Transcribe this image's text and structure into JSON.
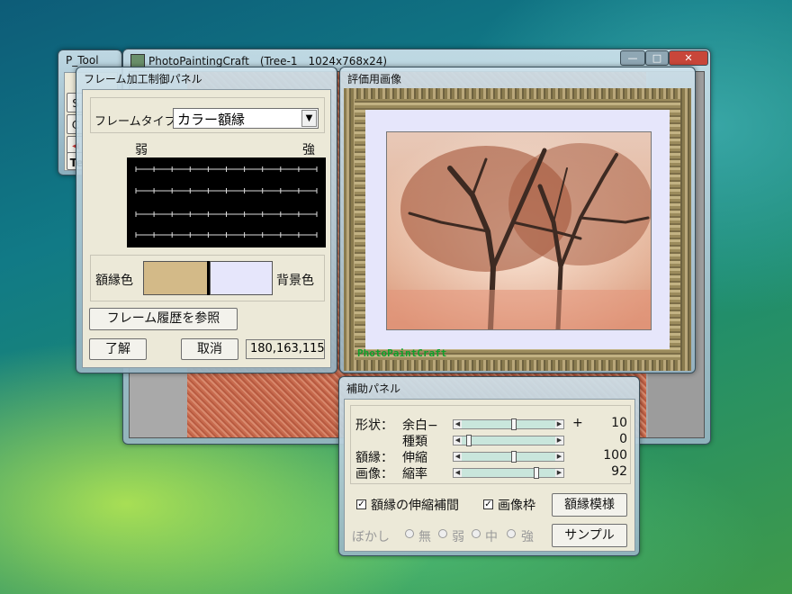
{
  "ptool": {
    "title": "P_Tool",
    "cells": [
      "",
      "S",
      "C",
      "◀",
      "Te"
    ]
  },
  "main": {
    "title": "PhotoPaintingCraft　(Tree-1　1024x768x24)",
    "min": "—",
    "max": "□",
    "close": "✕"
  },
  "frame_panel": {
    "title": "フレーム加工制御パネル",
    "type_label": "フレームタイプ：",
    "type_value": "カラー額縁",
    "weak": "弱",
    "strong": "強",
    "frame_color_label": "額縁色",
    "bg_color_label": "背景色",
    "frame_color": "#d3ba88",
    "bg_color": "#e6e6fb",
    "history_button": "フレーム履歴を参照",
    "ok_button": "了解",
    "cancel_button": "取消",
    "rgb_value": "180,163,115"
  },
  "eval_panel": {
    "title": "評価用画像",
    "watermark": "PhotoPaintCraft"
  },
  "aux_panel": {
    "title": "補助パネル",
    "shape_label": "形状：",
    "margin_label": "余白−",
    "plus": "+",
    "type_label": "種類",
    "frame_label": "額縁：",
    "stretch_label": "伸縮",
    "image_label": "画像：",
    "scale_label": "縮率",
    "rows": [
      {
        "value": "10",
        "level": 0.55
      },
      {
        "value": "0",
        "level": 0.05
      },
      {
        "value": "100",
        "level": 0.55
      },
      {
        "value": "92",
        "level": 0.8
      }
    ],
    "check_stretch": "額縁の伸縮補間",
    "check_image_frame": "画像枠",
    "pattern_button": "額縁模様",
    "blur_label": "ぼかし",
    "blur_options": [
      "無",
      "弱",
      "中",
      "強"
    ],
    "sample_button": "サンプル"
  }
}
